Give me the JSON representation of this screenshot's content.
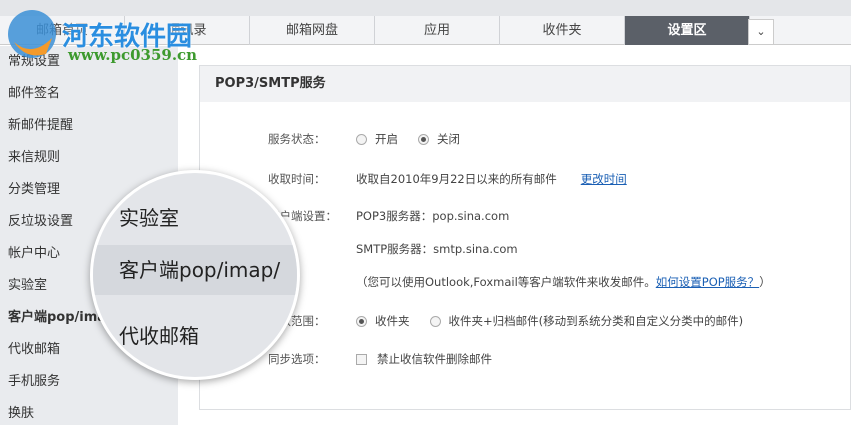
{
  "watermark": {
    "title": "河东软件园",
    "url": "www.pc0359.cn"
  },
  "tabs": [
    {
      "label": "邮箱首页"
    },
    {
      "label": "通讯录"
    },
    {
      "label": "邮箱网盘"
    },
    {
      "label": "应用"
    },
    {
      "label": "收件夹"
    },
    {
      "label": "设置区"
    }
  ],
  "dropdown": "⌄",
  "sidebar": {
    "items": [
      {
        "label": "常规设置"
      },
      {
        "label": "邮件签名"
      },
      {
        "label": "新邮件提醒"
      },
      {
        "label": "来信规则"
      },
      {
        "label": "分类管理"
      },
      {
        "label": "反垃圾设置"
      },
      {
        "label": "帐户中心"
      },
      {
        "label": "实验室"
      },
      {
        "label": "客户端pop/imap"
      },
      {
        "label": "代收邮箱"
      },
      {
        "label": "手机服务"
      },
      {
        "label": "换肤"
      }
    ]
  },
  "magnifier": {
    "items": [
      "实验室",
      "客户端pop/imap/",
      "代收邮箱"
    ]
  },
  "panel": {
    "title": "POP3/SMTP服务",
    "service_status": {
      "label": "服务状态：",
      "options": [
        "开启",
        "关闭"
      ],
      "selected": "关闭"
    },
    "fetch_time": {
      "label": "收取时间：",
      "value": "收取自2010年9月22日以来的所有邮件",
      "link": "更改时间"
    },
    "client": {
      "label": "客户端设置：",
      "pop3": "POP3服务器：pop.sina.com",
      "smtp": "SMTP服务器：smtp.sina.com",
      "note_pre": "（您可以使用Outlook,Foxmail等客户端软件来收发邮件。",
      "note_link": "如何设置POP服务？",
      "note_post": "）"
    },
    "range": {
      "label": "收取范围：",
      "options": [
        "收件夹",
        "收件夹+归档邮件(移动到系统分类和自定义分类中的邮件)"
      ],
      "selected": "收件夹"
    },
    "sync": {
      "label": "同步选项：",
      "checkbox": "禁止收信软件删除邮件",
      "checked": false
    }
  }
}
